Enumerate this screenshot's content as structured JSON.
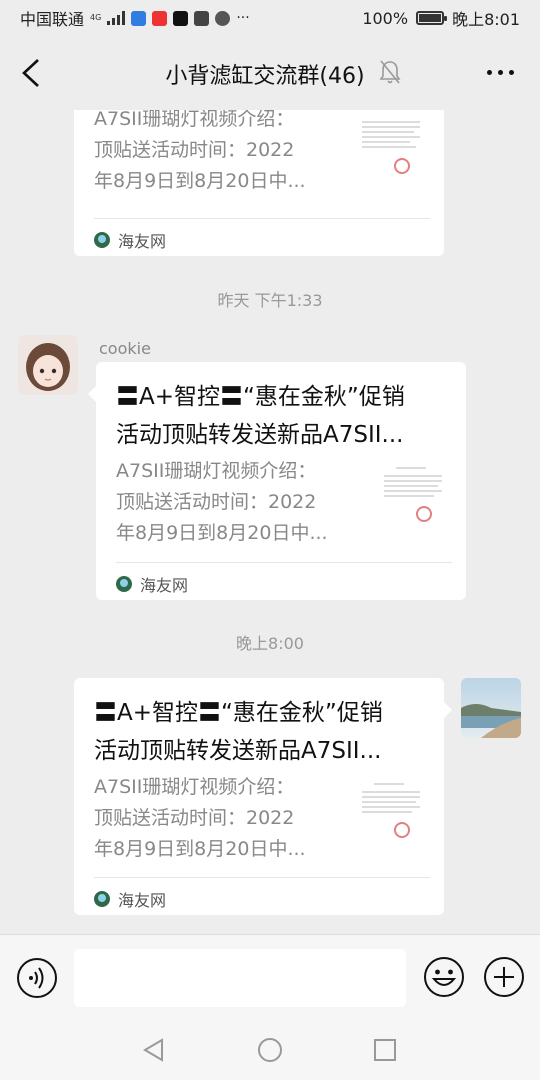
{
  "status_bar": {
    "carrier": "中国联通",
    "network": "4G",
    "battery": "100%",
    "battery_level": 1.0,
    "time": "晚上8:01",
    "more": "···"
  },
  "header": {
    "title": "小背滤缸交流群(46)"
  },
  "messages": [
    {
      "type": "link_card",
      "from": "self",
      "title": "",
      "description": "A7SII珊瑚灯视频介绍：顶贴送活动时间：2022年8月9日到8月20日中...",
      "desc_lines": [
        "A7SII珊瑚灯视频介绍：",
        "顶贴送活动时间：2022",
        "年8月9日到8月20日中..."
      ],
      "source": "海友网"
    },
    {
      "type": "time",
      "text": "昨天 下午1:33"
    },
    {
      "type": "link_card",
      "from": "other",
      "sender": "cookie",
      "title_lines": [
        "〓A+智控〓“惠在金秋”促销",
        "活动顶贴转发送新品A7SII..."
      ],
      "desc_lines": [
        "A7SII珊瑚灯视频介绍：",
        "顶贴送活动时间：2022",
        "年8月9日到8月20日中..."
      ],
      "source": "海友网"
    },
    {
      "type": "time",
      "text": "晚上8:00"
    },
    {
      "type": "link_card",
      "from": "self",
      "title_lines": [
        "〓A+智控〓“惠在金秋”促销",
        "活动顶贴转发送新品A7SII..."
      ],
      "desc_lines": [
        "A7SII珊瑚灯视频介绍：",
        "顶贴送活动时间：2022",
        "年8月9日到8月20日中..."
      ],
      "source": "海友网"
    }
  ],
  "input": {
    "value": "",
    "placeholder": ""
  },
  "icons": {
    "back": "chevron-left-icon",
    "mute": "bell-off-icon",
    "more": "more-horizontal-icon",
    "voice": "voice-icon",
    "emoji": "emoji-icon",
    "plus": "plus-circle-icon",
    "nav_back": "triangle-back-icon",
    "nav_home": "circle-home-icon",
    "nav_recent": "square-recent-icon"
  },
  "colors": {
    "background": "#ededed",
    "card": "#ffffff",
    "muted_text": "#888888"
  }
}
